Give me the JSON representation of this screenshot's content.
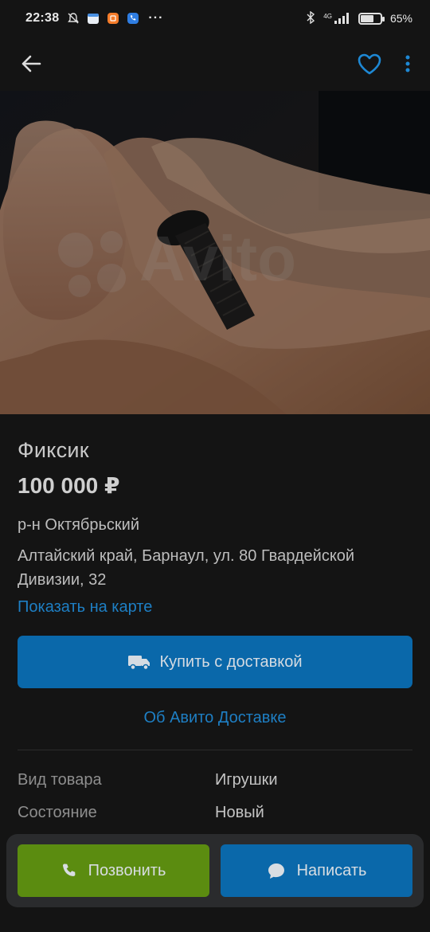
{
  "status_bar": {
    "time": "22:38",
    "more": "···",
    "network": "4G",
    "battery": "65%",
    "battery_level": 0.65
  },
  "toolbar": {
    "back_icon": "arrow-left-icon",
    "favorite_icon": "heart-outline-icon",
    "more_icon": "more-vertical-icon",
    "accent": "#1e88d4"
  },
  "listing": {
    "photo_watermark": "Avito",
    "title": "Фиксик",
    "price": "100 000 ₽",
    "district": "р-н Октябрьский",
    "address": "Алтайский край, Барнаул, ул. 80 Гвардейской Дивизии, 32",
    "map_link": "Показать на карте",
    "buy_button": "Купить с доставкой",
    "delivery_link": "Об Авито Доставке",
    "params": [
      {
        "key": "Вид товара",
        "value": "Игрушки"
      },
      {
        "key": "Состояние",
        "value": "Новый"
      }
    ]
  },
  "actions": {
    "call": "Позвонить",
    "write": "Написать",
    "call_color": "#5b8c10",
    "write_color": "#0a68aa"
  }
}
